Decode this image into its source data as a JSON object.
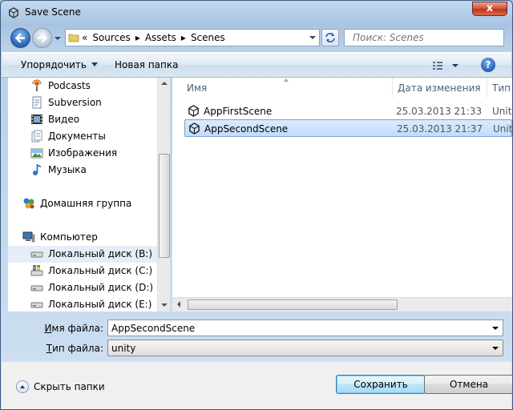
{
  "window": {
    "title": "Save Scene",
    "close_label": "x"
  },
  "nav": {
    "breadcrumb_prefix": "«",
    "breadcrumb": [
      "Sources",
      "Assets",
      "Scenes"
    ],
    "search_placeholder": "Поиск: Scenes"
  },
  "toolbar": {
    "organize_label": "Упорядочить",
    "new_folder_label": "Новая папка",
    "help_label": "?"
  },
  "sidebar": {
    "items": [
      {
        "label": "Podcasts",
        "icon": "podcast-icon"
      },
      {
        "label": "Subversion",
        "icon": "document-icon"
      },
      {
        "label": "Видео",
        "icon": "video-icon"
      },
      {
        "label": "Документы",
        "icon": "documents-icon"
      },
      {
        "label": "Изображения",
        "icon": "images-icon"
      },
      {
        "label": "Музыка",
        "icon": "music-icon"
      },
      {
        "label": "Домашняя группа",
        "icon": "homegroup-icon"
      },
      {
        "label": "Компьютер",
        "icon": "computer-icon"
      },
      {
        "label": "Локальный диск (B:)",
        "icon": "drive-icon",
        "highlighted": true
      },
      {
        "label": "Локальный диск (C:)",
        "icon": "windows-drive-icon"
      },
      {
        "label": "Локальный диск (D:)",
        "icon": "drive-icon"
      },
      {
        "label": "Локальный диск (E:)",
        "icon": "drive-icon"
      }
    ]
  },
  "files": {
    "columns": [
      "Имя",
      "Дата изменения",
      "Тип"
    ],
    "rows": [
      {
        "name": "AppFirstScene",
        "date": "25.03.2013 21:33",
        "type": "Unity",
        "selected": false
      },
      {
        "name": "AppSecondScene",
        "date": "25.03.2013 21:37",
        "type": "Unity",
        "selected": true
      }
    ]
  },
  "form": {
    "filename_label_u": "И",
    "filename_label_rest": "мя файла:",
    "filename_value": "AppSecondScene",
    "filetype_label_u": "Т",
    "filetype_label_rest": "ип файла:",
    "filetype_value": "unity"
  },
  "footer": {
    "hide_folders_label": "Скрыть папки",
    "save_label": "Сохранить",
    "cancel_label": "Отмена"
  },
  "colors": {
    "accent": "#2f6fb9",
    "selection": "#c1dbfc",
    "close": "#c0341c"
  }
}
